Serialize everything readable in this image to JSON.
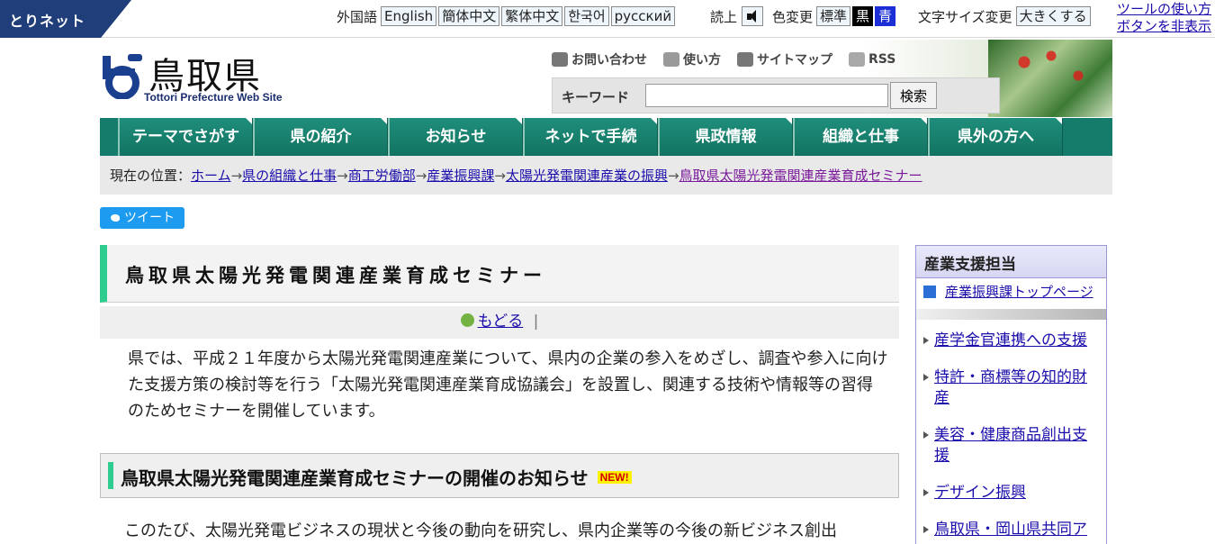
{
  "toolbar": {
    "badge": "とりネット",
    "lang_label": "外国語",
    "languages": [
      "English",
      "簡体中文",
      "繁体中文",
      "한국어",
      "русский"
    ],
    "read_label": "読上",
    "color_label": "色変更",
    "color_options": [
      "標準",
      "黒",
      "青"
    ],
    "size_label": "文字サイズ変更",
    "size_button": "大きくする",
    "help_link": "ツールの使い方",
    "hide_link": "ボタンを非表示"
  },
  "header": {
    "title": "鳥取県",
    "subtitle": "Tottori Prefecture Web Site",
    "links": [
      "お問い合わせ",
      "使い方",
      "サイトマップ",
      "RSS"
    ],
    "search_label": "キーワード",
    "search_value": "",
    "search_button": "検索"
  },
  "nav": [
    "テーマでさがす",
    "県の紹介",
    "お知らせ",
    "ネットで手続",
    "県政情報",
    "組織と仕事",
    "県外の方へ"
  ],
  "breadcrumb": {
    "label": "現在の位置：",
    "items": [
      "ホーム",
      "県の組織と仕事",
      "商工労働部",
      "産業振興課",
      "太陽光発電関連産業の振興",
      "鳥取県太陽光発電関連産業育成セミナー"
    ],
    "separator": "→"
  },
  "tweet": "ツイート",
  "main": {
    "title": "鳥取県太陽光発電関連産業育成セミナー",
    "back": "もどる",
    "back_sep": "|",
    "intro": "県では、平成２１年度から太陽光発電関連産業について、県内の企業の参入をめざし、調査や参入に向けた支援方策の検討等を行う「太陽光発電関連産業育成協議会」を設置し、関連する技術や情報等の習得のためセミナーを開催しています。",
    "section_title": "鳥取県太陽光発電関連産業育成セミナーの開催のお知らせ",
    "new_badge": "NEW!",
    "body": "このたび、太陽光発電ビジネスの現状と今後の動向を研究し、県内企業等の今後の新ビジネス創出"
  },
  "sidebar": {
    "title": "産業支援担当",
    "top_link": "産業振興課トップページ",
    "items": [
      "産学金官連携への支援",
      "特許・商標等の知的財産",
      "美容・健康商品創出支援",
      "デザイン振興",
      "鳥取県・岡山県共同ア"
    ]
  }
}
